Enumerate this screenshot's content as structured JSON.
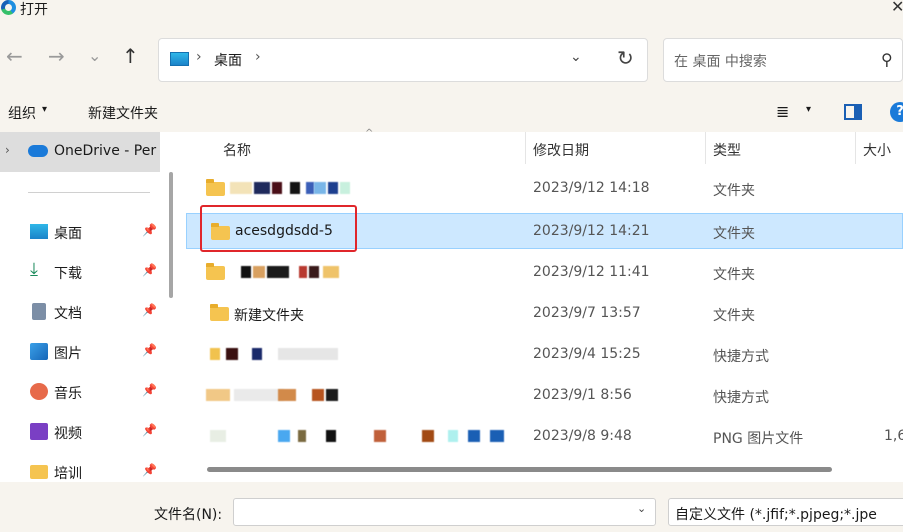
{
  "window": {
    "title": "打开",
    "close_glyph": "✕"
  },
  "nav": {
    "back_glyph": "←",
    "forward_glyph": "→",
    "recent_glyph": "⌄",
    "up_glyph": "↑"
  },
  "address": {
    "separator": "›",
    "location": "桌面",
    "dropdown_glyph": "⌄",
    "refresh_glyph": "↻"
  },
  "search": {
    "placeholder": "在 桌面 中搜索",
    "icon": "⚲"
  },
  "toolbar": {
    "organize": "组织",
    "caret": "▾",
    "new_folder": "新建文件夹",
    "view_glyph": "≣",
    "help_glyph": "?"
  },
  "sidebar": {
    "onedrive": "OneDrive - Per",
    "chevron": "›",
    "pin_glyph": "📌",
    "items": [
      {
        "label": "桌面",
        "icon": "desktop-icon"
      },
      {
        "label": "下载",
        "icon": "download-icon"
      },
      {
        "label": "文档",
        "icon": "document-icon"
      },
      {
        "label": "图片",
        "icon": "pictures-icon"
      },
      {
        "label": "音乐",
        "icon": "music-icon"
      },
      {
        "label": "视频",
        "icon": "video-icon"
      },
      {
        "label": "培训",
        "icon": "folder-icon"
      }
    ]
  },
  "columns": {
    "name": "名称",
    "modified": "修改日期",
    "type": "类型",
    "size": "大小",
    "sort_glyph": "^"
  },
  "files": [
    {
      "name": "",
      "date": "2023/9/12 14:18",
      "type": "文件夹",
      "size": ""
    },
    {
      "name": "acesdgdsdd-5",
      "date": "2023/9/12 14:21",
      "type": "文件夹",
      "size": ""
    },
    {
      "name": "",
      "date": "2023/9/12 11:41",
      "type": "文件夹",
      "size": ""
    },
    {
      "name": "新建文件夹",
      "date": "2023/9/7 13:57",
      "type": "文件夹",
      "size": ""
    },
    {
      "name": "",
      "date": "2023/9/4 15:25",
      "type": "快捷方式",
      "size": ""
    },
    {
      "name": "",
      "date": "2023/9/1 8:56",
      "type": "快捷方式",
      "size": ""
    },
    {
      "name": "",
      "date": "2023/9/8 9:48",
      "type": "PNG 图片文件",
      "size": "1,6"
    }
  ],
  "bottom": {
    "filename_label": "文件名(N):",
    "filename_value": "",
    "filename_caret": "⌄",
    "filter": "自定义文件 (*.jfif;*.pjpeg;*.jpe"
  },
  "colors": {
    "chrome_bg": "#f7f4ee",
    "selected_row": "#cde8ff",
    "highlight_border": "#e0262b",
    "folder_yellow": "#f5c450"
  }
}
